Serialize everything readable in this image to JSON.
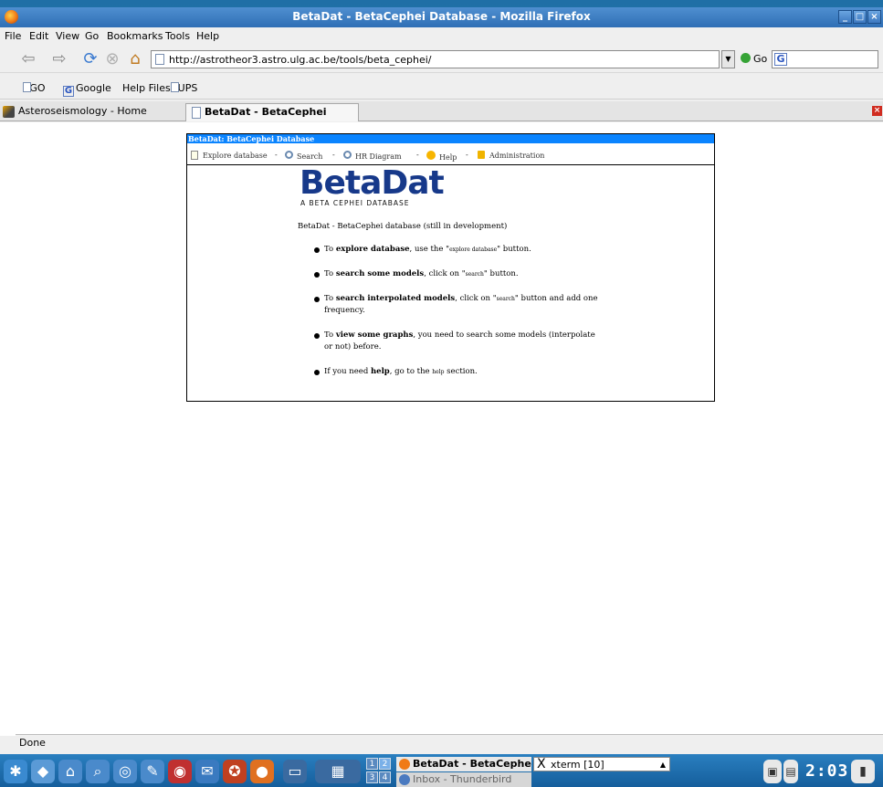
{
  "window": {
    "title": "BetaDat - BetaCephei Database - Mozilla Firefox"
  },
  "menubar": {
    "items": [
      "File",
      "Edit",
      "View",
      "Go",
      "Bookmarks",
      "Tools",
      "Help"
    ]
  },
  "navbar": {
    "url": "http://astrotheor3.astro.ulg.ac.be/tools/beta_cephei/",
    "go_label": "Go",
    "search_engine_glyph": "G"
  },
  "bookmarks": {
    "items": [
      "AGO",
      "Google",
      "Help Files",
      "CUPS"
    ]
  },
  "tabs": [
    {
      "label": "Asteroseismology - Home"
    },
    {
      "label": "BetaDat - BetaCephei Datab..."
    }
  ],
  "page": {
    "card_title": "BetaDat: BetaCephei Database",
    "nav": {
      "explore": "Explore database",
      "search": "Search",
      "hr": "HR Diagram",
      "help": "Help",
      "admin": "Administration",
      "separator": "-"
    },
    "logo": {
      "main": "BetaDat",
      "sub": "A BETA CEPHEI DATABASE"
    },
    "intro": "BetaDat - BetaCephei database (still in development)",
    "bullets": [
      {
        "pre": "To ",
        "bold": "explore database",
        "mid": ", use the \"",
        "small": "explore database",
        "post": "\" button.",
        "post2": ""
      },
      {
        "pre": "To ",
        "bold": "search some models",
        "mid": ", click on \"",
        "small": "search",
        "post": "\" button.",
        "post2": ""
      },
      {
        "pre": "To ",
        "bold": "search interpolated models",
        "mid": ", click on \"",
        "small": "search",
        "post": "\" button and add one",
        "post2": "frequency."
      },
      {
        "pre": "To ",
        "bold": "view some graphs",
        "mid": ", you need to search some models (interpolate",
        "small": "",
        "post": "",
        "post2": "or not) before."
      },
      {
        "pre": "If you need ",
        "bold": "help",
        "mid": ", go to the ",
        "small": "help",
        "post": " section.",
        "post2": ""
      }
    ]
  },
  "statusbar": {
    "text": "Done"
  },
  "taskbar": {
    "pager": [
      "1",
      "2",
      "3",
      "4"
    ],
    "tasks": [
      "BetaDat - BetaCephe",
      "xterm [10]",
      "Inbox - Thunderbird"
    ],
    "xterm_glyph": "X",
    "clock": "2:03"
  },
  "colors": {
    "titlebar": "#2f6fb5",
    "card_title_bg": "#0a84ff",
    "logo": "#17398a",
    "taskbar": "#155e9c"
  }
}
